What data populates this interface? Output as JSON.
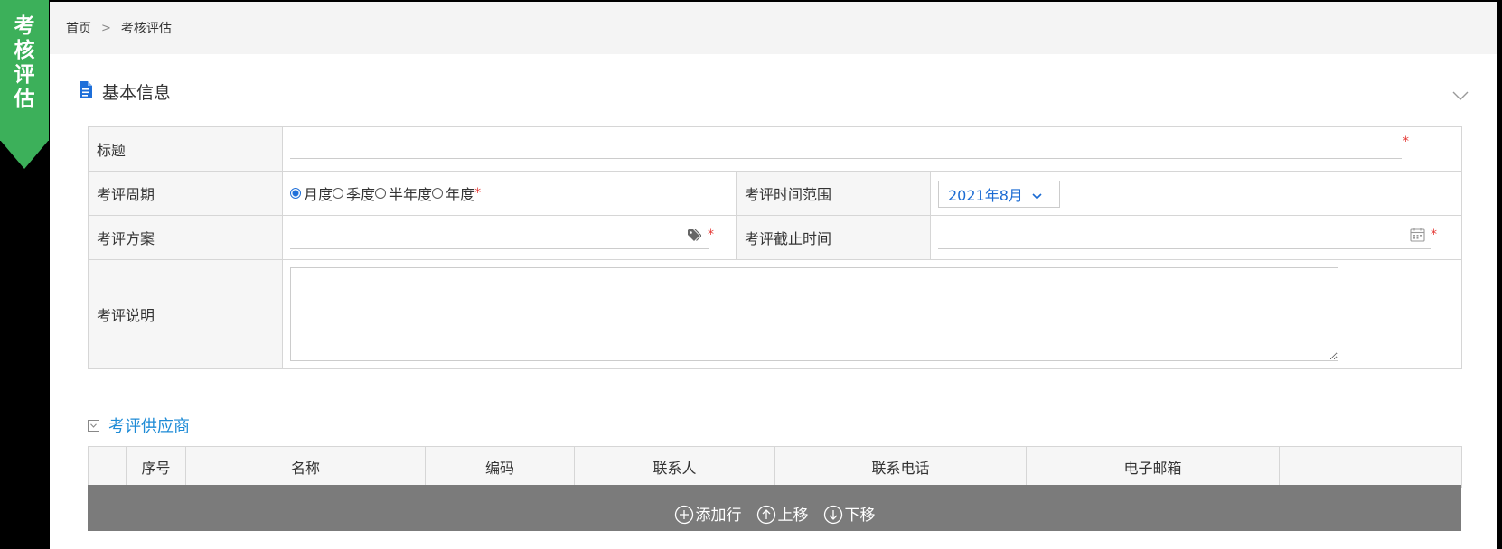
{
  "ribbon": {
    "chars": [
      "考",
      "核",
      "评",
      "估"
    ],
    "color": "#3cb05a"
  },
  "breadcrumb": {
    "home": "首页",
    "separator": ">",
    "current": "考核评估"
  },
  "section": {
    "title": "基本信息"
  },
  "form": {
    "title_label": "标题",
    "cycle_label": "考评周期",
    "cycle_options": [
      "月度",
      "季度",
      "半年度",
      "年度"
    ],
    "cycle_selected": "月度",
    "range_label": "考评时间范围",
    "range_value": "2021年8月",
    "plan_label": "考评方案",
    "deadline_label": "考评截止时间",
    "desc_label": "考评说明",
    "required_mark": "*"
  },
  "vendors": {
    "title": "考评供应商",
    "columns": [
      "",
      "序号",
      "名称",
      "编码",
      "联系人",
      "联系电话",
      "电子邮箱",
      ""
    ],
    "actions": {
      "add": "添加行",
      "up": "上移",
      "down": "下移"
    }
  },
  "colors": {
    "accent_blue": "#1e6fd9",
    "link_blue": "#1e8bd6",
    "required_red": "#e53935",
    "action_bar": "#7b7b7b"
  }
}
